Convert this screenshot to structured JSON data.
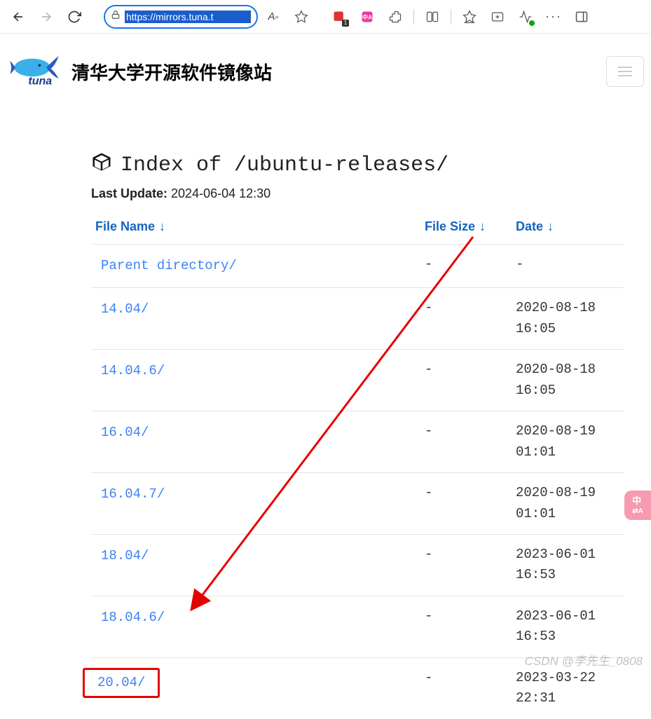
{
  "browser": {
    "url": "https://mirrors.tuna.t",
    "ext_badge": "1"
  },
  "siteHeader": {
    "title": "清华大学开源软件镜像站"
  },
  "page": {
    "index_prefix": "Index of",
    "index_path": "/ubuntu-releases/",
    "last_update_label": "Last Update:",
    "last_update_value": "2024-06-04 12:30"
  },
  "columns": {
    "name": "File Name",
    "size": "File Size",
    "date": "Date",
    "arrow": "↓"
  },
  "rows": [
    {
      "name": "Parent directory/",
      "size": "-",
      "date": "-",
      "highlight": false
    },
    {
      "name": "14.04/",
      "size": "-",
      "date": "2020-08-18 16:05",
      "highlight": false
    },
    {
      "name": "14.04.6/",
      "size": "-",
      "date": "2020-08-18 16:05",
      "highlight": false
    },
    {
      "name": "16.04/",
      "size": "-",
      "date": "2020-08-19 01:01",
      "highlight": false
    },
    {
      "name": "16.04.7/",
      "size": "-",
      "date": "2020-08-19 01:01",
      "highlight": false
    },
    {
      "name": "18.04/",
      "size": "-",
      "date": "2023-06-01 16:53",
      "highlight": false
    },
    {
      "name": "18.04.6/",
      "size": "-",
      "date": "2023-06-01 16:53",
      "highlight": false
    },
    {
      "name": "20.04/",
      "size": "-",
      "date": "2023-03-22 22:31",
      "highlight": true
    }
  ],
  "watermark": "CSDN @李先生_0808"
}
